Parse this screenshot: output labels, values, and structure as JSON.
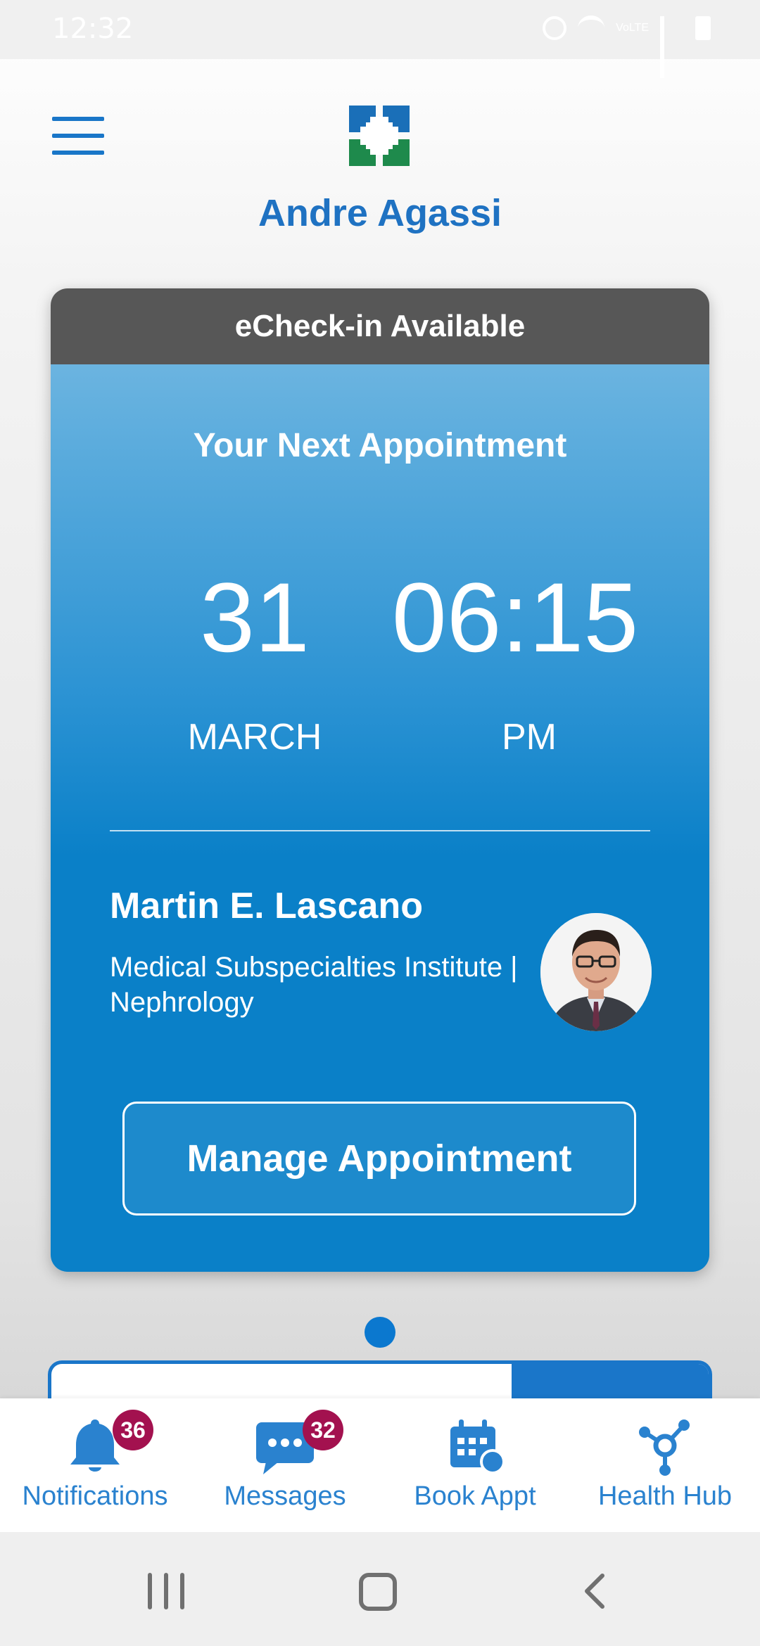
{
  "status_bar": {
    "time": "12:32",
    "volte_label": "VoLTE"
  },
  "header": {
    "user_name": "Andre Agassi"
  },
  "card": {
    "status": "eCheck-in Available",
    "title": "Your Next Appointment",
    "day": "31",
    "month": "MARCH",
    "time": "06:15",
    "ampm": "PM",
    "doctor_name": "Martin E. Lascano",
    "department": "Medical Subspecialties Institute | Nephrology",
    "manage_label": "Manage Appointment"
  },
  "tabs": [
    {
      "label": "Notifications",
      "icon": "bell-icon",
      "badge": "36"
    },
    {
      "label": "Messages",
      "icon": "chat-icon",
      "badge": "32"
    },
    {
      "label": "Book Appt",
      "icon": "calendar-icon"
    },
    {
      "label": "Health Hub",
      "icon": "hub-icon"
    }
  ],
  "colors": {
    "brand_blue": "#1f72c2",
    "brand_green": "#1e8a4c",
    "badge": "#a3114f",
    "header_gray": "#575757"
  }
}
